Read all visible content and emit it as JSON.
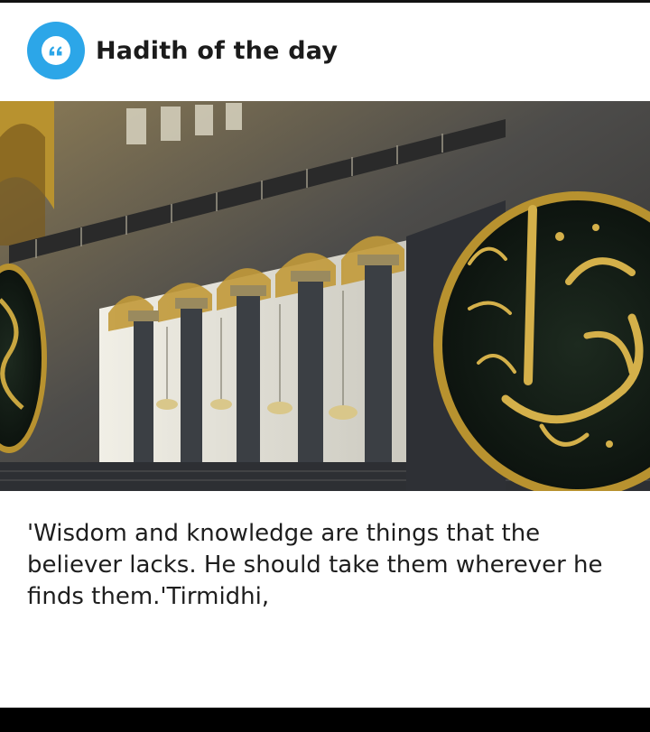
{
  "header": {
    "icon": "quote-icon",
    "icon_color": "#2CA6E8",
    "title": "Hadith of the day"
  },
  "image": {
    "alt": "Interior arches and columns with a large circular calligraphy medallion"
  },
  "hadith": {
    "text": "'Wisdom and knowledge are things that the believer lacks. He should take them wherever he finds them.'Tirmidhi,"
  }
}
